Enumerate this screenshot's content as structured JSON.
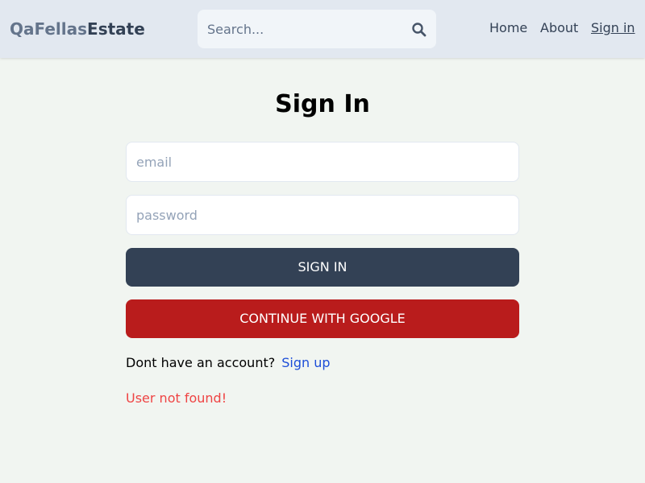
{
  "header": {
    "logo_part1": "QaFellas",
    "logo_part2": "Estate",
    "search": {
      "placeholder": "Search...",
      "value": "",
      "icon": "search-icon"
    },
    "nav": {
      "home": "Home",
      "about": "About",
      "sign_in": "Sign in"
    }
  },
  "form": {
    "title": "Sign In",
    "email_placeholder": "email",
    "email_value": "",
    "password_placeholder": "password",
    "password_value": "",
    "sign_in_button": "SIGN IN",
    "google_button": "CONTINUE WITH GOOGLE",
    "account_prompt": "Dont have an account?",
    "sign_up_link": "Sign up",
    "error_message": "User not found!"
  },
  "colors": {
    "header_bg": "#e2e8f0",
    "page_bg": "#f1f5f1",
    "primary_button": "#334155",
    "google_button": "#b91c1c",
    "link": "#1d4ed8",
    "error": "#ef4444"
  }
}
